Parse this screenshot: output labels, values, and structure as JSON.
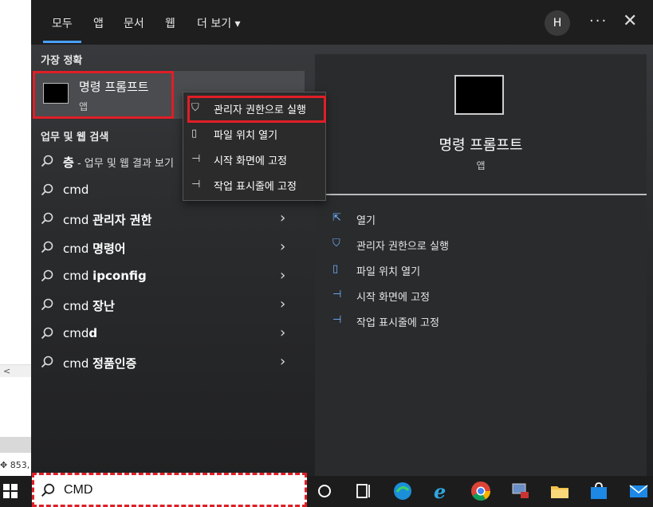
{
  "tabs": [
    "모두",
    "앱",
    "문서",
    "웹",
    "더 보기"
  ],
  "tab_more_arrow": "▾",
  "avatar_letter": "H",
  "more_label": "···",
  "close_label": "✕",
  "section_best": "가장 정확",
  "best_match": {
    "title": "명령 프롬프트",
    "subtitle": "앱"
  },
  "section_web": "업무 및 웹 검색",
  "web_results": [
    {
      "bold": "층",
      "rest": " - 업무 및 웹 결과 보기",
      "chevron": false
    },
    {
      "bold": "",
      "rest": "cmd",
      "chevron": false
    },
    {
      "pre": "cmd ",
      "bold": "관리자 권한",
      "chevron": true
    },
    {
      "pre": "cmd ",
      "bold": "명령어",
      "chevron": true
    },
    {
      "pre": "cmd ",
      "bold": "ipconfig",
      "chevron": true
    },
    {
      "pre": "cmd ",
      "bold": "장난",
      "chevron": true
    },
    {
      "pre": "cmd",
      "bold": "d",
      "chevron": true
    },
    {
      "pre": "cmd ",
      "bold": "정품인증",
      "chevron": true
    }
  ],
  "chevron_glyph": "›",
  "context_menu": [
    {
      "label": "관리자 권한으로 실행",
      "icon": "shield-icon"
    },
    {
      "label": "파일 위치 열기",
      "icon": "file-icon"
    },
    {
      "label": "시작 화면에 고정",
      "icon": "pin-icon"
    },
    {
      "label": "작업 표시줄에 고정",
      "icon": "pin-icon"
    }
  ],
  "right_panel": {
    "title": "명령 프롬프트",
    "subtitle": "앱",
    "actions": [
      {
        "label": "열기",
        "icon": "open-icon"
      },
      {
        "label": "관리자 권한으로 실행",
        "icon": "shield-icon"
      },
      {
        "label": "파일 위치 열기",
        "icon": "file-icon"
      },
      {
        "label": "시작 화면에 고정",
        "icon": "pin-icon"
      },
      {
        "label": "작업 표시줄에 고정",
        "icon": "pin-icon"
      }
    ]
  },
  "search_box": {
    "value": "CMD"
  },
  "desktop": {
    "scroll_arrow": "<",
    "coords": "853,"
  },
  "colors": {
    "accent": "#4aa0ff",
    "highlight": "#e01e26",
    "panel": "#2b2c2e"
  }
}
